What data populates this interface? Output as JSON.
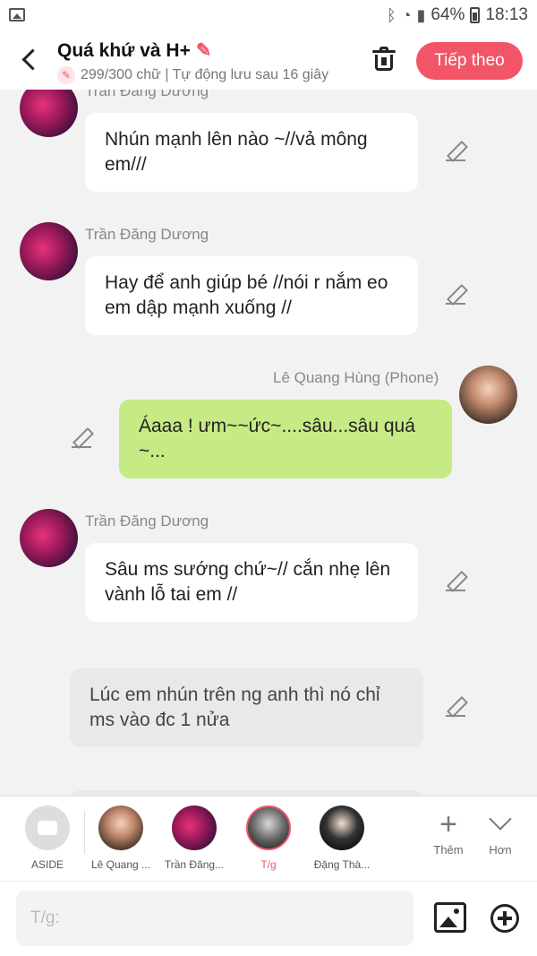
{
  "status": {
    "battery": "64%",
    "time": "18:13"
  },
  "header": {
    "title": "Quá khứ và H+",
    "subtitle": "299/300 chữ | Tự động lưu sau 16 giây",
    "next_label": "Tiếp theo"
  },
  "messages": [
    {
      "sender": "Trần Đăng Dương",
      "text": "Nhún mạnh lên nào ~//vả mông em///"
    },
    {
      "sender": "Trần Đăng Dương",
      "text": "Hay để anh giúp bé //nói r nắm eo em dập mạnh xuống //"
    },
    {
      "sender": "Lê Quang Hùng (Phone)",
      "text": "Áaaa ! ưm~~ức~....sâu...sâu quá ~..."
    },
    {
      "sender": "Trần Đăng Dương",
      "text": "Sâu ms sướng chứ~// cắn nhẹ lên vành lỗ tai em //"
    },
    {
      "text": "Lúc em nhún trên ng anh thì nó chỉ ms vào đc 1 nửa"
    }
  ],
  "characters": [
    {
      "name": "ASIDE"
    },
    {
      "name": "Lê Quang ..."
    },
    {
      "name": "Trần Đăng..."
    },
    {
      "name": "T/g"
    },
    {
      "name": "Đặng Thà..."
    }
  ],
  "more": {
    "add_label": "Thêm",
    "more_label": "Hơn"
  },
  "input": {
    "placeholder": "T/g:"
  }
}
